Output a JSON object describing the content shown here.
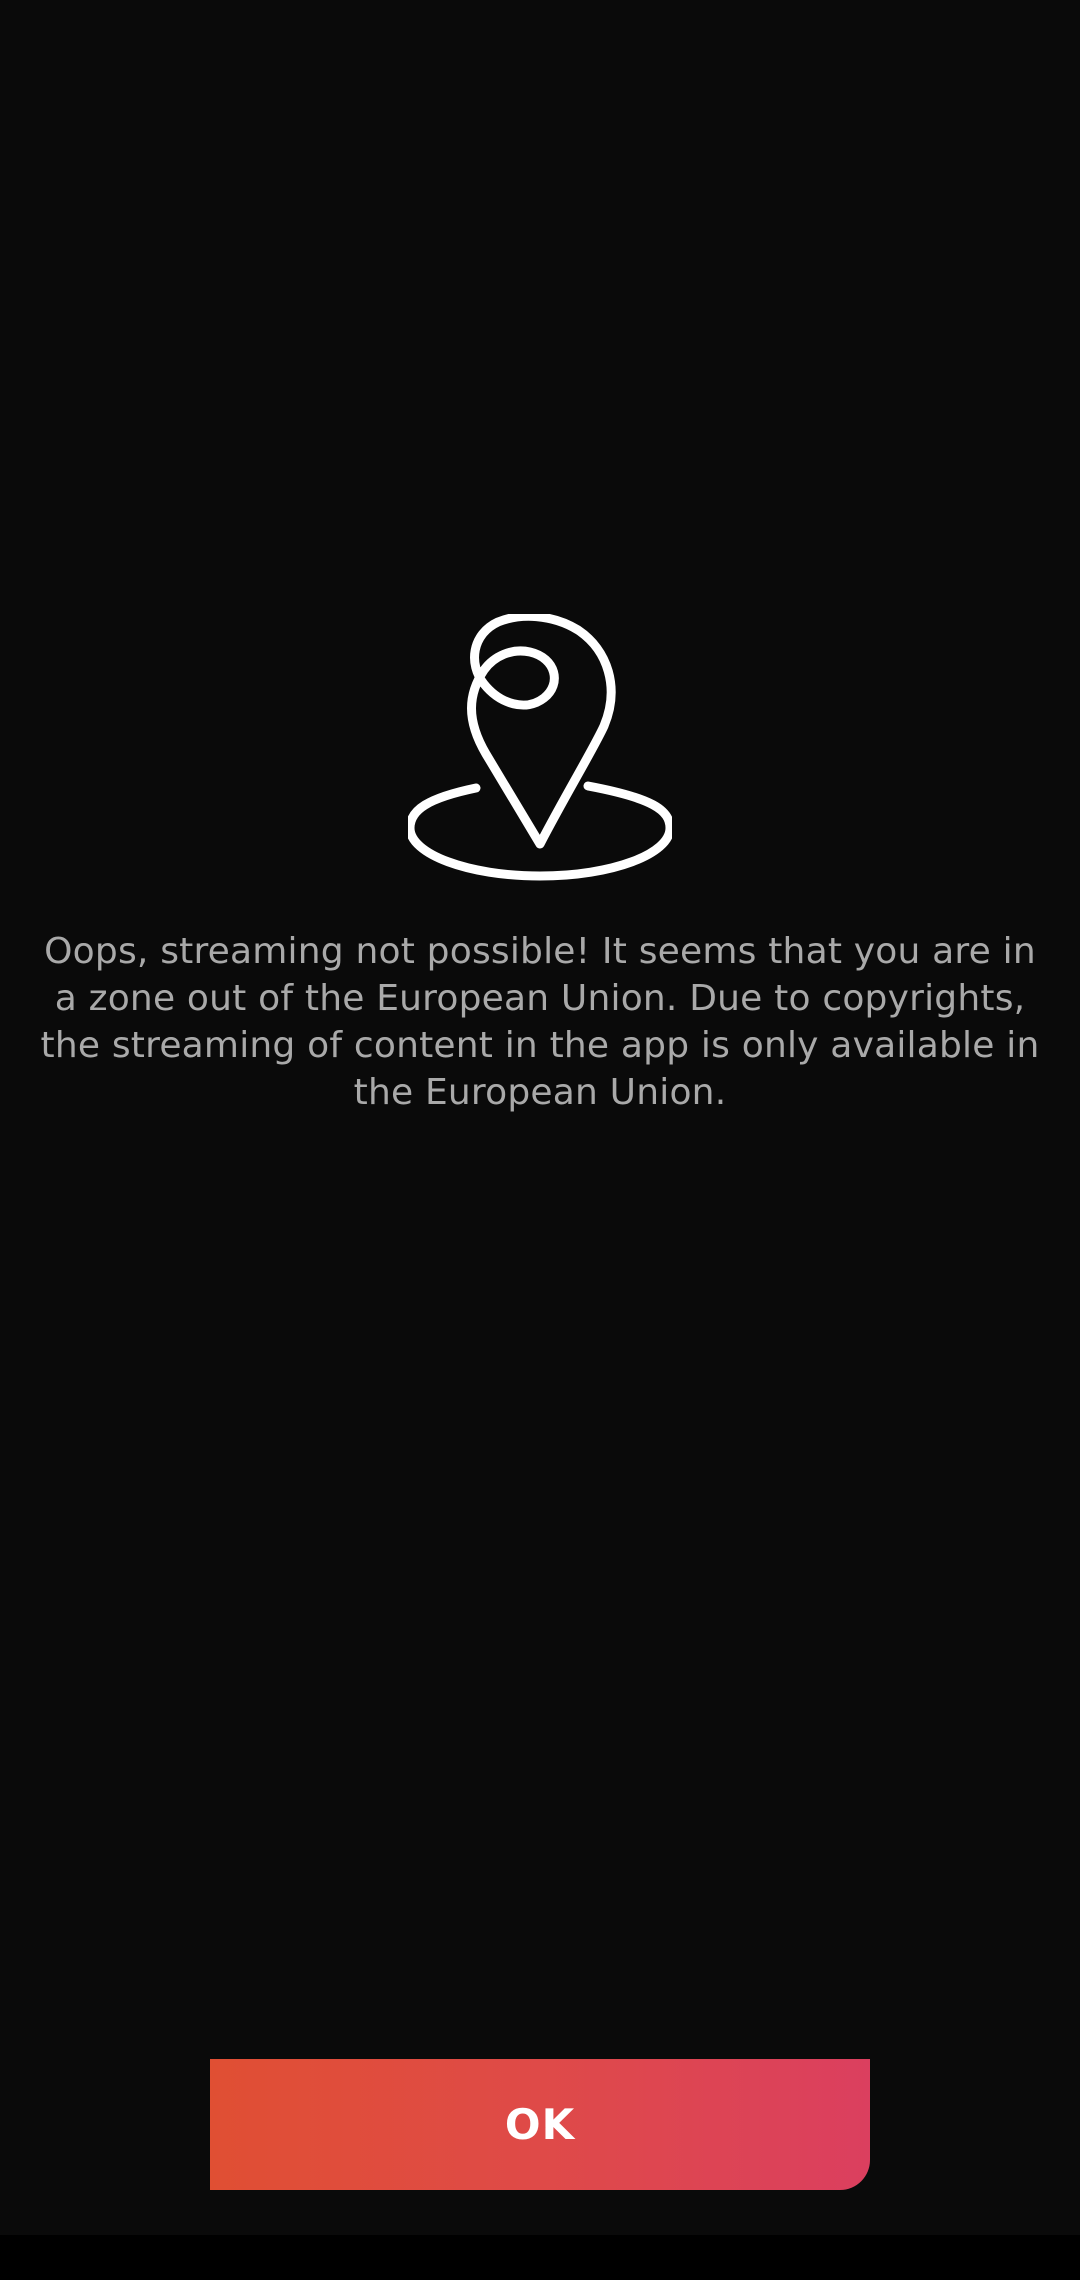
{
  "dialog": {
    "icon": "location-pin-icon",
    "message": "Oops, streaming not possible! It seems that you are in a zone out of the European Union. Due to copyrights, the streaming of content in the app is only available in the European Union."
  },
  "actions": {
    "ok_label": "OK"
  },
  "colors": {
    "background": "#0a0a0a",
    "message_text": "#a9a9a9",
    "button_gradient_start": "#e04f33",
    "button_gradient_end": "#db3f5f",
    "icon_stroke": "#ffffff"
  }
}
